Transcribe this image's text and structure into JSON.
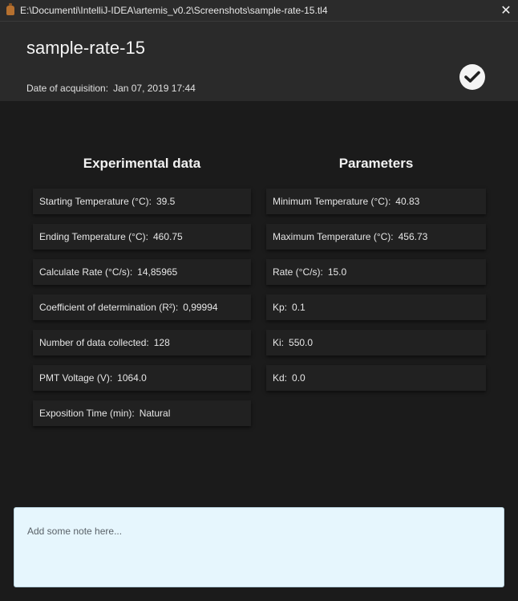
{
  "window": {
    "title": "E:\\Documenti\\IntelliJ-IDEA\\artemis_v0.2\\Screenshots\\sample-rate-15.tl4",
    "close_glyph": "✕"
  },
  "header": {
    "sample_name": "sample-rate-15",
    "acquisition_label": "Date of acquisition:",
    "acquisition_value": "Jan 07, 2019 17:44"
  },
  "experimental": {
    "title": "Experimental data",
    "items": [
      {
        "label": "Starting Temperature (°C):",
        "value": "39.5"
      },
      {
        "label": "Ending Temperature (°C):",
        "value": "460.75"
      },
      {
        "label": "Calculate Rate (°C/s):",
        "value": "14,85965"
      },
      {
        "label": "Coefficient of determination (R²):",
        "value": "0,99994"
      },
      {
        "label": "Number of  data collected:",
        "value": "128"
      },
      {
        "label": "PMT Voltage (V):",
        "value": "1064.0"
      },
      {
        "label": "Exposition Time (min):",
        "value": "Natural"
      }
    ]
  },
  "parameters": {
    "title": "Parameters",
    "items": [
      {
        "label": "Minimum Temperature (°C):",
        "value": "40.83"
      },
      {
        "label": "Maximum Temperature (°C):",
        "value": "456.73"
      },
      {
        "label": "Rate (°C/s):",
        "value": "15.0"
      },
      {
        "label": "Kp:",
        "value": "0.1"
      },
      {
        "label": "Ki:",
        "value": "550.0"
      },
      {
        "label": "Kd:",
        "value": "0.0"
      }
    ]
  },
  "notes": {
    "placeholder": "Add some note here..."
  },
  "colors": {
    "background": "#1b1b1b",
    "header": "#2a2a2a",
    "card": "#212121",
    "notes_bg": "#e6f6fd"
  },
  "icons": {
    "app": "coffee-cup-icon",
    "close": "close-icon",
    "confirm": "check-circle-icon"
  }
}
